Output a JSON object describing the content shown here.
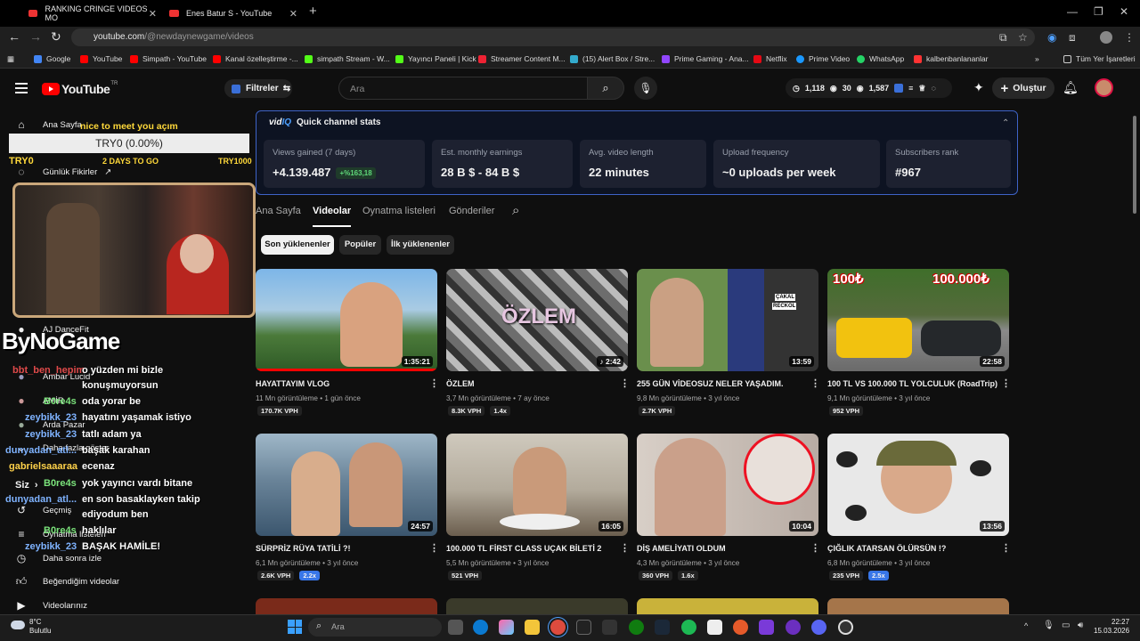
{
  "browser": {
    "tabs": [
      {
        "title": "RANKING CRINGE VIDEOS MO"
      },
      {
        "title": "Enes Batur S - YouTube"
      }
    ],
    "url_host": "youtube.com",
    "url_path": "/@newdaynewgame/videos",
    "bookmarks": [
      "Google",
      "YouTube",
      "Simpath - YouTube",
      "Kanal özelleştirme -...",
      "simpath Stream - W...",
      "Yayıncı Paneli | Kick",
      "Streamer Content M...",
      "(15) Alert Box / Stre...",
      "Prime Gaming - Ana...",
      "Netflix",
      "Prime Video",
      "WhatsApp",
      "kalbenbanlananlar"
    ],
    "bookmarks_all": "Tüm Yer İşaretleri"
  },
  "header": {
    "logo": "YouTube",
    "logo_sup": "TR",
    "filters_label": "Filtreler",
    "search_placeholder": "Ara",
    "stat1": "1,118",
    "stat2": "30",
    "stat3": "1,587",
    "create_label": "Oluştur"
  },
  "sidebar": {
    "items": [
      {
        "label": "Ana Sayfa",
        "icon": "home-icon"
      },
      {
        "label": "Günlük Fikirler",
        "icon": "lightbulb-icon"
      },
      {
        "label": "AJ DanceFit",
        "icon": "avatar"
      },
      {
        "label": "Ambar Lucid",
        "icon": "avatar"
      },
      {
        "label": "AMİR",
        "icon": "avatar"
      },
      {
        "label": "Arda Pazar",
        "icon": "avatar"
      },
      {
        "label": "Daha fazla göster",
        "icon": "chevron-down-icon"
      },
      {
        "label": "Siz",
        "icon": "chevron-right-icon"
      },
      {
        "label": "Geçmiş",
        "icon": "history-icon"
      },
      {
        "label": "Oynatma listeleri",
        "icon": "playlist-icon"
      },
      {
        "label": "Daha sonra izle",
        "icon": "clock-icon"
      },
      {
        "label": "Beğendiğim videolar",
        "icon": "like-icon"
      },
      {
        "label": "Videolarınız",
        "icon": "video-icon"
      }
    ]
  },
  "overlay": {
    "nice": "nice to meet you açım",
    "goal_bar": "TRY0 (0.00%)",
    "goal_left": "TRY0",
    "goal_mid": "2 DAYS TO GO",
    "goal_right": "TRY1000",
    "brand": "ByNoGame",
    "chat": [
      {
        "user": "bbt_ben_hepim",
        "msg": "o yüzden mi bizle"
      },
      {
        "user": "",
        "msg": "konuşmuyorsun"
      },
      {
        "user": "B0re4s",
        "msg": "oda yorar be"
      },
      {
        "user": "zeybikk_23",
        "msg": "hayatını yaşamak istiyo"
      },
      {
        "user": "zeybikk_23",
        "msg": "tatlı adam ya"
      },
      {
        "user": "dunyadan_atl...",
        "msg": "başak karahan"
      },
      {
        "user": "gabrielsaaaraa",
        "msg": "ecenaz"
      },
      {
        "user": "B0re4s",
        "msg": "yok yayıncı vardı bitane"
      },
      {
        "user": "dunyadan_atl...",
        "msg": "en son basaklayken takip"
      },
      {
        "user": "",
        "msg": "ediyodum ben"
      },
      {
        "user": "B0re4s",
        "msg": "haklılar"
      },
      {
        "user": "zeybikk_23",
        "msg": "BAŞAK HAMİLE!"
      }
    ]
  },
  "vidiq": {
    "title": "Quick channel stats",
    "logo_a": "vid",
    "logo_b": "IQ",
    "cards": [
      {
        "label": "Views gained (7 days)",
        "value": "+4.139.487",
        "badge": "+%163,18"
      },
      {
        "label": "Est. monthly earnings",
        "value": "28 B $ - 84 B $"
      },
      {
        "label": "Avg. video length",
        "value": "22 minutes"
      },
      {
        "label": "Upload frequency",
        "value": "~0 uploads per week"
      },
      {
        "label": "Subscribers rank",
        "value": "#967"
      }
    ]
  },
  "channel_tabs": [
    "Ana Sayfa",
    "Videolar",
    "Oynatma listeleri",
    "Gönderiler"
  ],
  "chips": [
    "Son yüklenenler",
    "Popüler",
    "İlk yüklenenler"
  ],
  "videos": [
    {
      "title": "HAYATTAYIM VLOG",
      "views": "11 Mn görüntüleme",
      "age": "1 gün önce",
      "duration": "1:35:21",
      "vph": "170.7K VPH",
      "mult": ""
    },
    {
      "title": "ÖZLEM",
      "views": "3,7 Mn görüntüleme",
      "age": "7 ay önce",
      "duration": "2:42",
      "vph": "8.3K VPH",
      "mult": "1.4x"
    },
    {
      "title": "255 GÜN VİDEOSUZ NELER YAŞADIM.",
      "views": "9,8 Mn görüntüleme",
      "age": "3 yıl önce",
      "duration": "13:59",
      "vph": "2.7K VPH",
      "mult": ""
    },
    {
      "title": "100 TL VS 100.000 TL YOLCULUK (RoadTrip)",
      "views": "9,1 Mn görüntüleme",
      "age": "3 yıl önce",
      "duration": "22:58",
      "vph": "952 VPH",
      "mult": ""
    },
    {
      "title": "SÜRPRİZ RÜYA TATİLİ ?!",
      "views": "6,1 Mn görüntüleme",
      "age": "3 yıl önce",
      "duration": "24:57",
      "vph": "2.6K VPH",
      "mult": "2.2x"
    },
    {
      "title": "100.000 TL FİRST CLASS UÇAK BİLETİ 2",
      "views": "5,5 Mn görüntüleme",
      "age": "3 yıl önce",
      "duration": "16:05",
      "vph": "521 VPH",
      "mult": ""
    },
    {
      "title": "DİŞ AMELİYATI OLDUM",
      "views": "4,3 Mn görüntüleme",
      "age": "3 yıl önce",
      "duration": "10:04",
      "vph": "360 VPH",
      "mult": "1.6x"
    },
    {
      "title": "ÇIĞLIK ATARSAN ÖLÜRSÜN !?",
      "views": "6,8 Mn görüntüleme",
      "age": "3 yıl önce",
      "duration": "13:56",
      "vph": "235 VPH",
      "mult": "2.5x"
    }
  ],
  "thumb_text": {
    "t2": "ÖZLEM",
    "t3a": "ÇAKAL",
    "t3b": "RECKOL",
    "t4a": "100₺",
    "t4b": "100.000₺"
  },
  "taskbar": {
    "temp": "8°C",
    "weather": "Bulutlu",
    "search": "Ara",
    "time": "22:27",
    "date": "15.03.2026"
  }
}
